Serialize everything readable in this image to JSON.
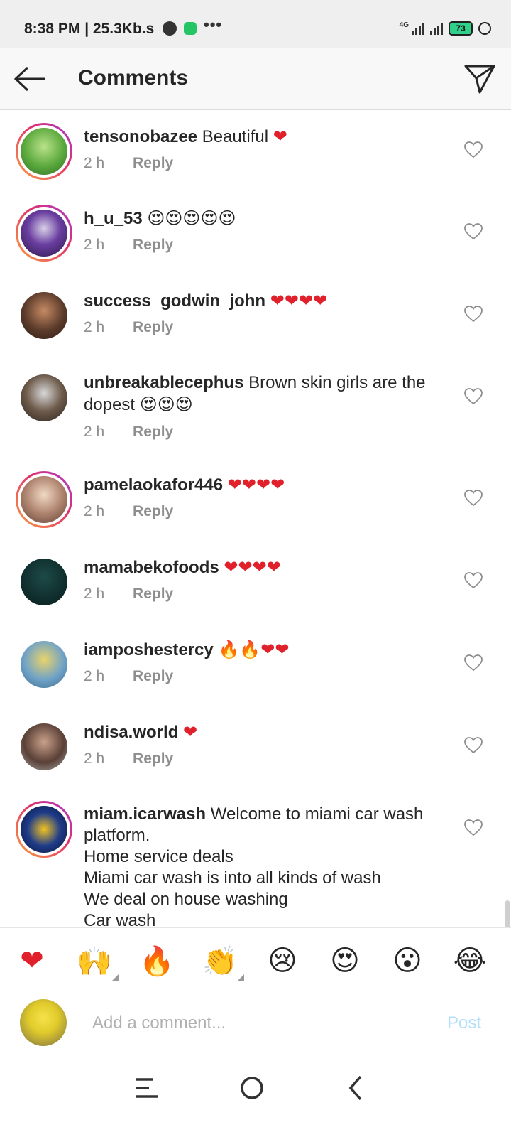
{
  "status_bar": {
    "time": "8:38 PM | 25.3Kb.s",
    "network": "4G",
    "battery": "73"
  },
  "header": {
    "title": "Comments",
    "back_icon": "arrow-left-icon",
    "send_icon": "paper-plane-icon"
  },
  "comments": [
    {
      "username": "tensonobazee",
      "text": " Beautiful ",
      "emoji": "❤",
      "time": "2 h",
      "reply": "Reply"
    },
    {
      "username": "h_u_53",
      "text": " ",
      "emoji": "😍😍😍😍😍",
      "time": "2 h",
      "reply": "Reply"
    },
    {
      "username": "success_godwin_john",
      "text": " ",
      "emoji": "❤❤❤❤",
      "time": "2 h",
      "reply": "Reply"
    },
    {
      "username": "unbreakablecephus",
      "text": " Brown skin girls are the dopest ",
      "emoji": "😍😍😍",
      "time": "2 h",
      "reply": "Reply"
    },
    {
      "username": "pamelaokafor446",
      "text": " ",
      "emoji": "❤❤❤❤",
      "time": "2 h",
      "reply": "Reply"
    },
    {
      "username": "mamabekofoods",
      "text": " ",
      "emoji": "❤❤❤❤",
      "time": "2 h",
      "reply": "Reply"
    },
    {
      "username": "iamposhestercy",
      "text": " ",
      "emoji": "🔥🔥❤❤",
      "time": "2 h",
      "reply": "Reply"
    },
    {
      "username": "ndisa.world",
      "text": " ",
      "emoji": "❤",
      "time": "2 h",
      "reply": "Reply"
    },
    {
      "username": "miam.icarwash",
      "text": " Welcome to miami car wash platform.",
      "lines": [
        "Home service deals",
        "Miami car wash is into all kinds of wash",
        "We deal on house washing",
        "Car wash"
      ],
      "time": "",
      "reply": ""
    }
  ],
  "emoji_bar": [
    "❤",
    "🙌",
    "🔥",
    "👏",
    "😢",
    "😍",
    "😮",
    "😂"
  ],
  "compose": {
    "placeholder": "Add a comment...",
    "post_label": "Post"
  },
  "colors": {
    "accent_blue_disabled": "#b2dffc",
    "heart_red": "#e0202a",
    "meta_gray": "#8e8e8e"
  }
}
